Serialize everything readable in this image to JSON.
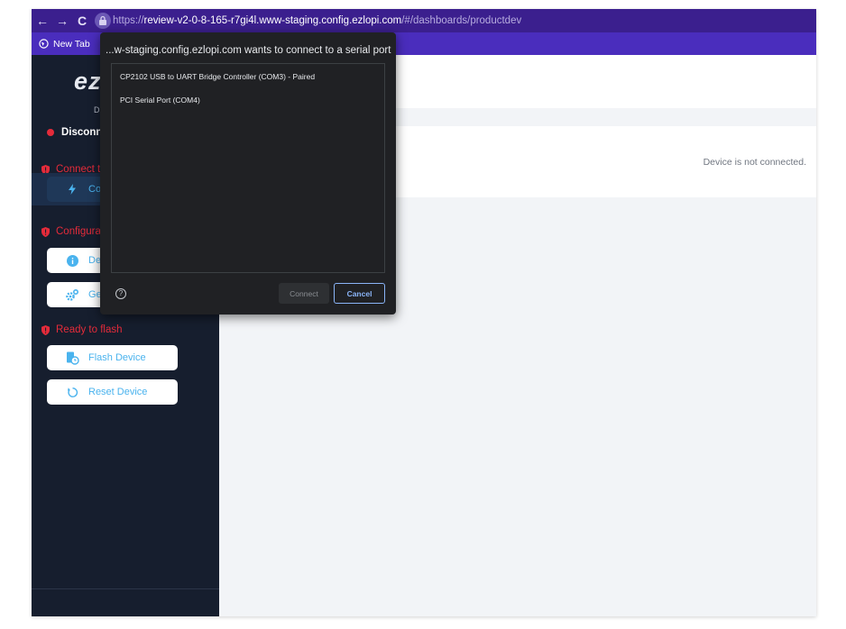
{
  "browser": {
    "url_prefix": "https://",
    "url_host": "review-v2-0-8-165-r7gi4l.www-staging.config.ezlopi.com",
    "url_path": "/#/dashboards/productdev",
    "bookmarks": [
      {
        "label": "New Tab"
      }
    ]
  },
  "sidebar": {
    "logo": "ez",
    "logo_sub": "D",
    "status": "Disconne",
    "sections": [
      {
        "label": "Connect t"
      },
      {
        "label": "Configura"
      },
      {
        "label": "Ready to flash"
      }
    ],
    "buttons": [
      {
        "label": "Co"
      },
      {
        "label": "De"
      },
      {
        "label": "Ge"
      },
      {
        "label": "Flash Device"
      },
      {
        "label": "Reset Device"
      }
    ]
  },
  "main": {
    "device_status": "Device is not connected."
  },
  "dialog": {
    "title": "...w-staging.config.ezlopi.com wants to connect to a serial port",
    "devices": [
      {
        "label": "CP2102 USB to UART Bridge Controller (COM3) - Paired"
      },
      {
        "label": "PCI Serial Port (COM4)"
      }
    ],
    "help": "?",
    "connect_label": "Connect",
    "cancel_label": "Cancel"
  },
  "colors": {
    "browser_bar": "#3b1f8e",
    "bookmarks_bar": "#4a2dbd",
    "sidebar": "#161e2e",
    "alert_red": "#e52b3a",
    "accent_blue": "#4ab3ee",
    "dialog_bg": "#202124"
  }
}
